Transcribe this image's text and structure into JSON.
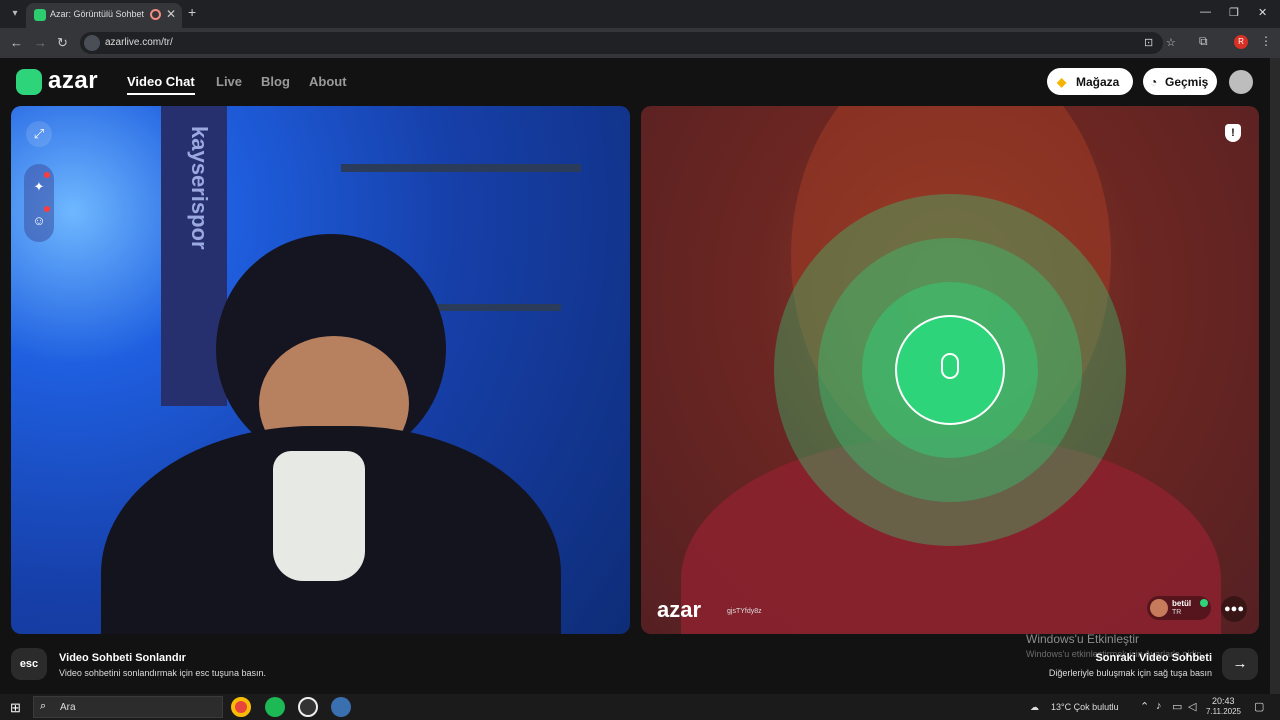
{
  "browser": {
    "tab_title": "Azar: Görüntülü Sohbet, Ye",
    "url": "azarlive.com/tr/",
    "profile_letter": "R"
  },
  "header": {
    "logo": "azar",
    "nav": [
      "Video Chat",
      "Live",
      "Blog",
      "About"
    ],
    "store_label": "Mağaza",
    "history_label": "Geçmiş"
  },
  "left_panel": {
    "banner_text": "kayserispor"
  },
  "right_panel": {
    "watermark_logo": "azar",
    "watermark_id": "gjsTYfdy8z",
    "partner_name": "betül",
    "partner_country": "TR"
  },
  "footer": {
    "esc_key": "esc",
    "end_title": "Video Sohbeti Sonlandır",
    "end_sub": "Video sohbetini sonlandırmak için esc tuşuna basın.",
    "next_title": "Sonraki Video Sohbeti",
    "next_sub": "Diğerleriyle buluşmak için sağ tuşa basın",
    "activate_title": "Windows'u Etkinleştir",
    "activate_sub": "Windows'u etkinleştirmek için Ayarlar'a gidin."
  },
  "taskbar": {
    "search_placeholder": "Ara",
    "weather": "13°C  Çok bulutlu",
    "time": "20:43",
    "date": "7.11.2025"
  },
  "colors": {
    "accent": "#2ed47a",
    "app_bg": "#121212"
  }
}
